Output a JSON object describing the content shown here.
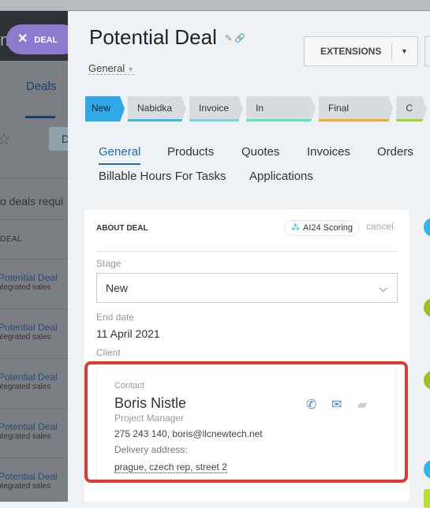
{
  "background": {
    "deal_pill": "DEAL",
    "deals_tab": "Deals",
    "filter_button": "D",
    "notice": "o deals requi",
    "column_header": "DEAL",
    "rows": [
      {
        "title": "Potential Deal",
        "subtitle": "ntegrated sales"
      },
      {
        "title": "Potential Deal",
        "subtitle": "ntegrated sales"
      },
      {
        "title": "Potential Deal",
        "subtitle": "ntegrated sales"
      },
      {
        "title": "Potential Deal",
        "subtitle": "ntegrated sales"
      },
      {
        "title": "Potential Deal",
        "subtitle": "ntegrated sales"
      }
    ]
  },
  "header": {
    "title": "Potential  Deal",
    "pipeline": "General",
    "extensions_label": "EXTENSIONS"
  },
  "stages": [
    {
      "label": "New",
      "color": "#2fa8e8"
    },
    {
      "label": "Nabidka",
      "color": "#39b9f0"
    },
    {
      "label": "Invoice",
      "color": "#6fd6e6"
    },
    {
      "label": "In progress",
      "color": "#5fe0c4"
    },
    {
      "label": "Final invoice",
      "color": "#f5a623"
    },
    {
      "label": "C",
      "color": "#9bd32a"
    }
  ],
  "tabs": [
    "General",
    "Products",
    "Quotes",
    "Invoices",
    "Orders",
    "Billable Hours For Tasks",
    "Applications"
  ],
  "about": {
    "heading": "ABOUT DEAL",
    "scoring": "AI24 Scoring",
    "cancel": "cancel",
    "stage_label": "Stage",
    "stage_value": "New",
    "end_date_label": "End date",
    "end_date_value": "11 April 2021",
    "client_label": "Client",
    "contact": {
      "type": "Contact",
      "name": "Boris Nistle",
      "position": "Project Manager",
      "phone_email": "275 243 140, boris@llcnewtech.net",
      "address_label": "Delivery address:",
      "address": "prague, czech rep, street 2"
    }
  },
  "highlight_color": "#e03b32"
}
